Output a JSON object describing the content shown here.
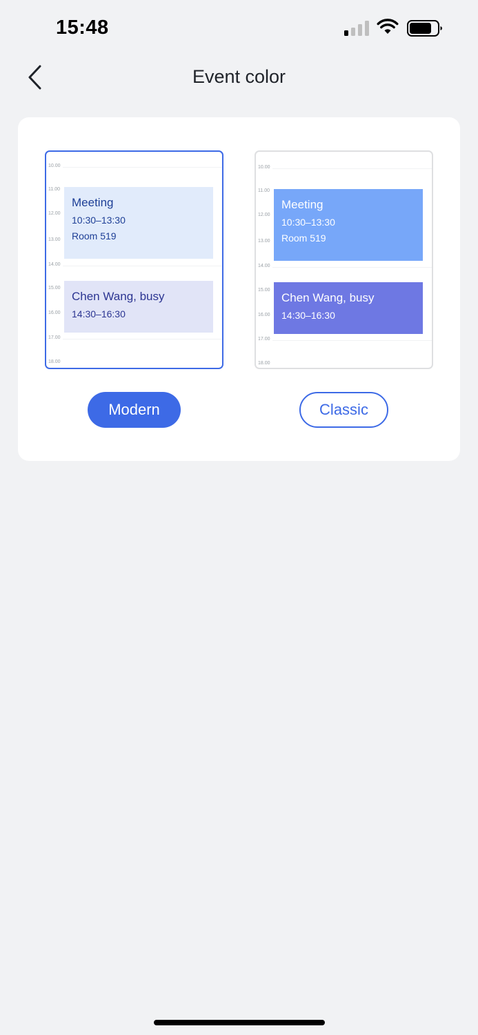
{
  "status_bar": {
    "time": "15:48"
  },
  "nav": {
    "title": "Event color",
    "back_icon": "chevron-left-icon"
  },
  "colors": {
    "accent": "#3d6ae6",
    "modern_meeting_bg": "#e1ebfb",
    "modern_busy_bg": "#e1e4f7",
    "classic_meeting_bg": "#77a7f9",
    "classic_busy_bg": "#6e78e3"
  },
  "previews": {
    "modern": {
      "selected": true,
      "ticks": [
        "10.00",
        "11.00",
        "12.00",
        "13.00",
        "14.00",
        "15.00",
        "16.00",
        "17.00",
        "18.00"
      ],
      "events": [
        {
          "title": "Meeting",
          "time": "10:30–13:30",
          "location": "Room 519"
        },
        {
          "title": "Chen Wang, busy",
          "time": "14:30–16:30"
        }
      ]
    },
    "classic": {
      "selected": false,
      "ticks": [
        "10.00",
        "11.00",
        "12.00",
        "13.00",
        "14.00",
        "15.00",
        "16.00",
        "17.00",
        "18.00"
      ],
      "events": [
        {
          "title": "Meeting",
          "time": "10:30–13:30",
          "location": "Room 519"
        },
        {
          "title": "Chen Wang, busy",
          "time": "14:30–16:30"
        }
      ]
    }
  },
  "options": {
    "modern_label": "Modern",
    "classic_label": "Classic"
  }
}
